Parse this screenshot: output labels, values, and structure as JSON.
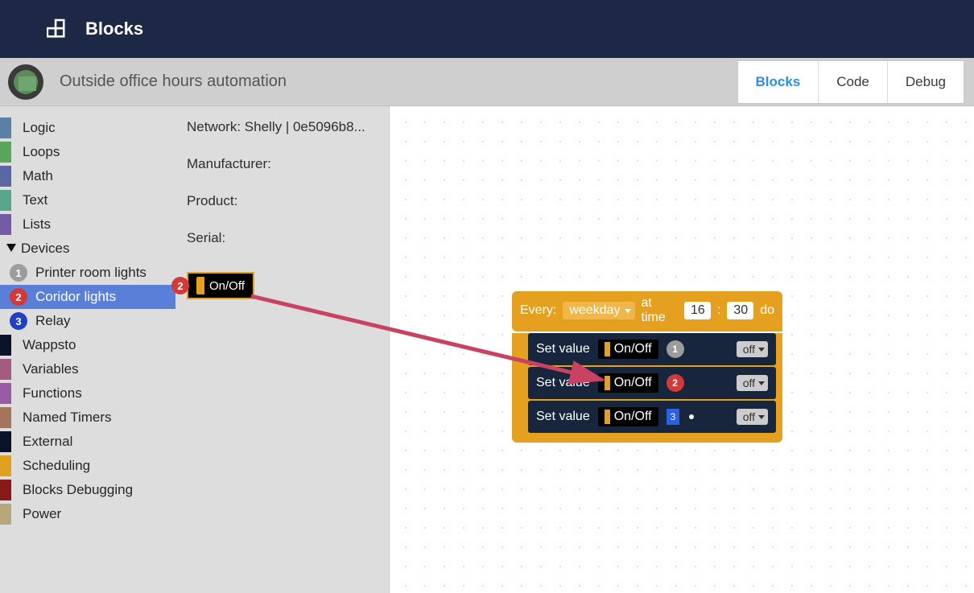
{
  "header": {
    "title": "Blocks"
  },
  "subheader": {
    "title": "Outside office hours automation",
    "tabs": {
      "blocks": "Blocks",
      "code": "Code",
      "debug": "Debug"
    }
  },
  "categories": {
    "logic": "Logic",
    "loops": "Loops",
    "math": "Math",
    "text": "Text",
    "lists": "Lists",
    "devices": "Devices",
    "wappsto": "Wappsto",
    "variables": "Variables",
    "functions": "Functions",
    "named_timers": "Named Timers",
    "external": "External",
    "scheduling": "Scheduling",
    "blocks_debugging": "Blocks Debugging",
    "power": "Power"
  },
  "devices": {
    "item1": {
      "num": "1",
      "label": "Printer room lights"
    },
    "item2": {
      "num": "2",
      "label": "Coridor lights"
    },
    "item3": {
      "num": "3",
      "label": "Relay"
    }
  },
  "flyout": {
    "network": "Network: Shelly | 0e5096b8...",
    "manufacturer": "Manufacturer:",
    "product": "Product:",
    "serial": "Serial:",
    "onoff": "On/Off",
    "badge": "2"
  },
  "workspace": {
    "every": {
      "label": "Every:",
      "weekday": "weekday",
      "at_time": "at time",
      "hour": "16",
      "colon": ":",
      "minute": "30",
      "do": "do"
    },
    "stmt": {
      "set_value": "Set value",
      "onoff": "On/Off",
      "off": "off"
    },
    "badges": {
      "b1": "1",
      "b2": "2",
      "b3": "3"
    }
  }
}
